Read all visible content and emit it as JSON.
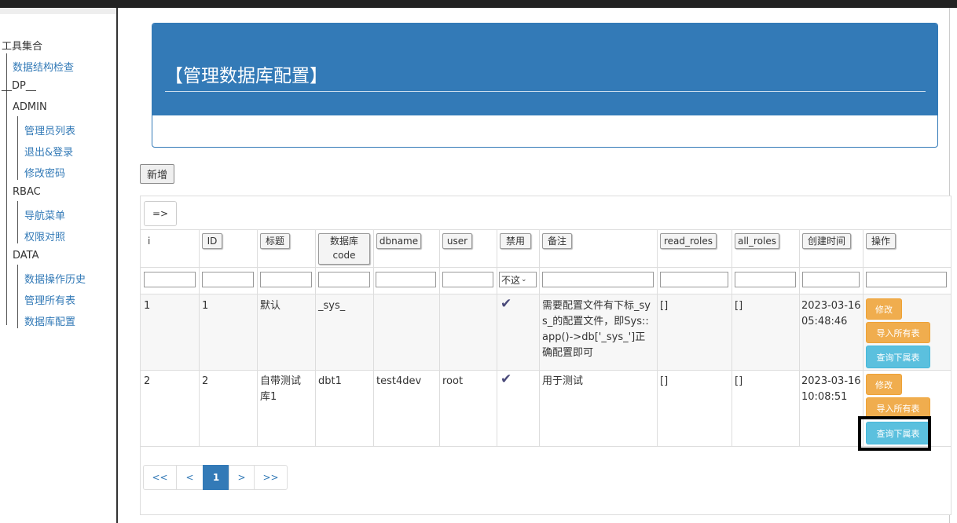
{
  "sidebar": {
    "root": "工具集合",
    "items": [
      {
        "label": "数据结构检查"
      },
      {
        "label": "__DP__"
      },
      {
        "label": "ADMIN"
      },
      {
        "label": "管理员列表"
      },
      {
        "label": "退出&登录"
      },
      {
        "label": "修改密码"
      },
      {
        "label": "RBAC"
      },
      {
        "label": "导航菜单"
      },
      {
        "label": "权限对照"
      },
      {
        "label": "DATA"
      },
      {
        "label": "数据操作历史"
      },
      {
        "label": "管理所有表"
      },
      {
        "label": "数据库配置"
      }
    ]
  },
  "panel": {
    "title": "【管理数据库配置】"
  },
  "toolbar": {
    "add_label": "新增",
    "toggle_label": "=>"
  },
  "table": {
    "headers": [
      "i",
      "ID",
      "标题",
      "数据库\ncode",
      "dbname",
      "user",
      "禁用",
      "备注",
      "read_roles",
      "all_roles",
      "创建时间",
      "操作"
    ],
    "filter_select": "不这",
    "rows": [
      {
        "i": "1",
        "id": "1",
        "title": "默认",
        "code": "_sys_",
        "dbname": "",
        "user": "",
        "disabled": true,
        "note": "需要配置文件有下标_sys_的配置文件，即Sys::app()->db['_sys_']正确配置即可",
        "read_roles": "[]",
        "all_roles": "[]",
        "created": "2023-03-16 05:48:46"
      },
      {
        "i": "2",
        "id": "2",
        "title": "自带测试库1",
        "code": "dbt1",
        "dbname": "test4dev",
        "user": "root",
        "disabled": true,
        "note": "用于测试",
        "read_roles": "[]",
        "all_roles": "[]",
        "created": "2023-03-16 10:08:51"
      }
    ],
    "actions": {
      "edit": "修改",
      "import": "导入所有表",
      "query": "查询下属表"
    }
  },
  "pagination": {
    "first": "<<",
    "prev": "<",
    "current": "1",
    "next": ">",
    "last": ">>"
  },
  "colors": {
    "primary": "#337ab7",
    "warning": "#f0ad4e",
    "info": "#5bc0de"
  },
  "icons": {
    "check": "check-icon"
  }
}
